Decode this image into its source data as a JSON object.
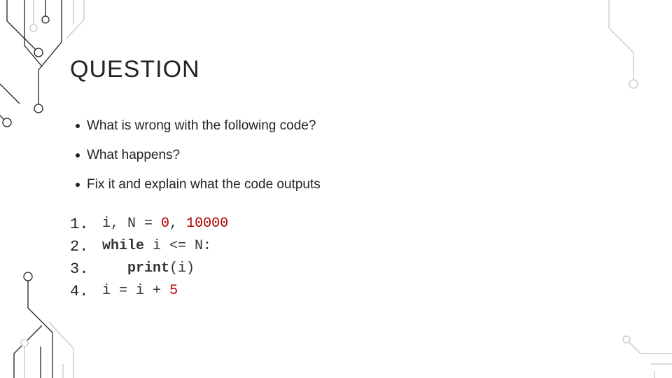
{
  "title": "QUESTION",
  "bullets": [
    "What is wrong with the following code?",
    "What happens?",
    "Fix it and explain what the code outputs"
  ],
  "code": {
    "line_numbers": [
      "1.",
      "2.",
      "3.",
      "4."
    ],
    "l1": {
      "a": "i, N ",
      "b": "= ",
      "c": "0",
      "d": ", ",
      "e": "10000"
    },
    "l2": {
      "a": "while",
      "b": " i ",
      "c": "<=",
      "d": " N:"
    },
    "l3": {
      "a": "print",
      "b": "(i)"
    },
    "l4": {
      "a": "i ",
      "b": "=",
      "c": " i ",
      "d": "+ ",
      "e": "5"
    }
  }
}
